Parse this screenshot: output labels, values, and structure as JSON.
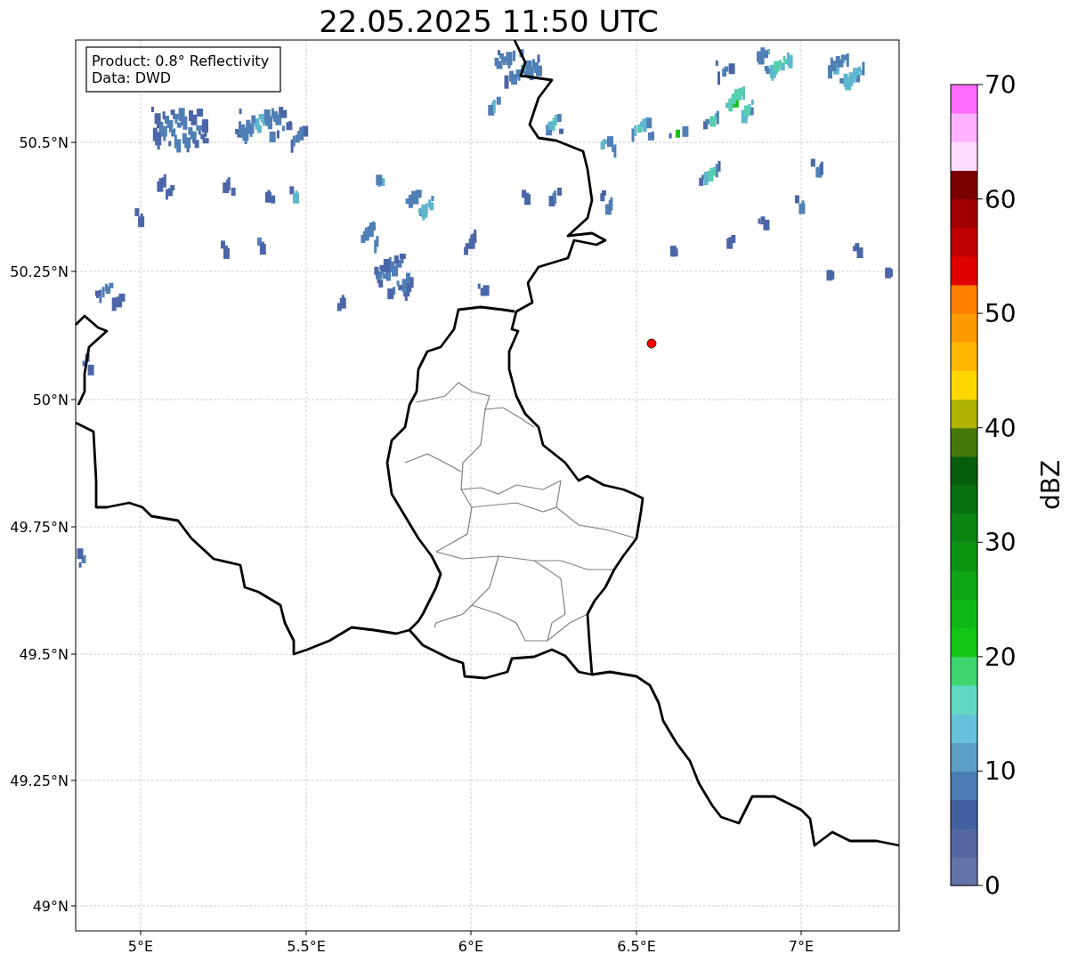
{
  "title": "22.05.2025 11:50 UTC",
  "info_box": [
    "Product: 0.8° Reflectivity",
    "Data: DWD"
  ],
  "y_ticks": [
    "50.5°N",
    "50.25°N",
    "50°N",
    "49.75°N",
    "49.5°N",
    "49.25°N",
    "49°N"
  ],
  "x_ticks": [
    "5°E",
    "5.5°E",
    "6°E",
    "6.5°E",
    "7°E"
  ],
  "colorbar": {
    "label": "dBZ",
    "ticks": [
      "70",
      "60",
      "50",
      "40",
      "30",
      "20",
      "10",
      "0"
    ],
    "bands": [
      {
        "color": "#6473a8"
      },
      {
        "color": "#5467a0"
      },
      {
        "color": "#4360a0"
      },
      {
        "color": "#4b7db4"
      },
      {
        "color": "#5b9fc7"
      },
      {
        "color": "#66c0d9"
      },
      {
        "color": "#61d7c4"
      },
      {
        "color": "#3dd66f"
      },
      {
        "color": "#12c615"
      },
      {
        "color": "#10b816"
      },
      {
        "color": "#0ea615"
      },
      {
        "color": "#0c9412"
      },
      {
        "color": "#0a8310"
      },
      {
        "color": "#08700e"
      },
      {
        "color": "#065d0b"
      },
      {
        "color": "#457a0b"
      },
      {
        "color": "#b0b300"
      },
      {
        "color": "#ffd700"
      },
      {
        "color": "#ffb700"
      },
      {
        "color": "#ff9b00"
      },
      {
        "color": "#ff7e00"
      },
      {
        "color": "#e00000"
      },
      {
        "color": "#c00000"
      },
      {
        "color": "#a00000"
      },
      {
        "color": "#7a0000"
      },
      {
        "color": "#ffdcff"
      },
      {
        "color": "#ffb1ff"
      },
      {
        "color": "#ff6cff"
      }
    ]
  }
}
